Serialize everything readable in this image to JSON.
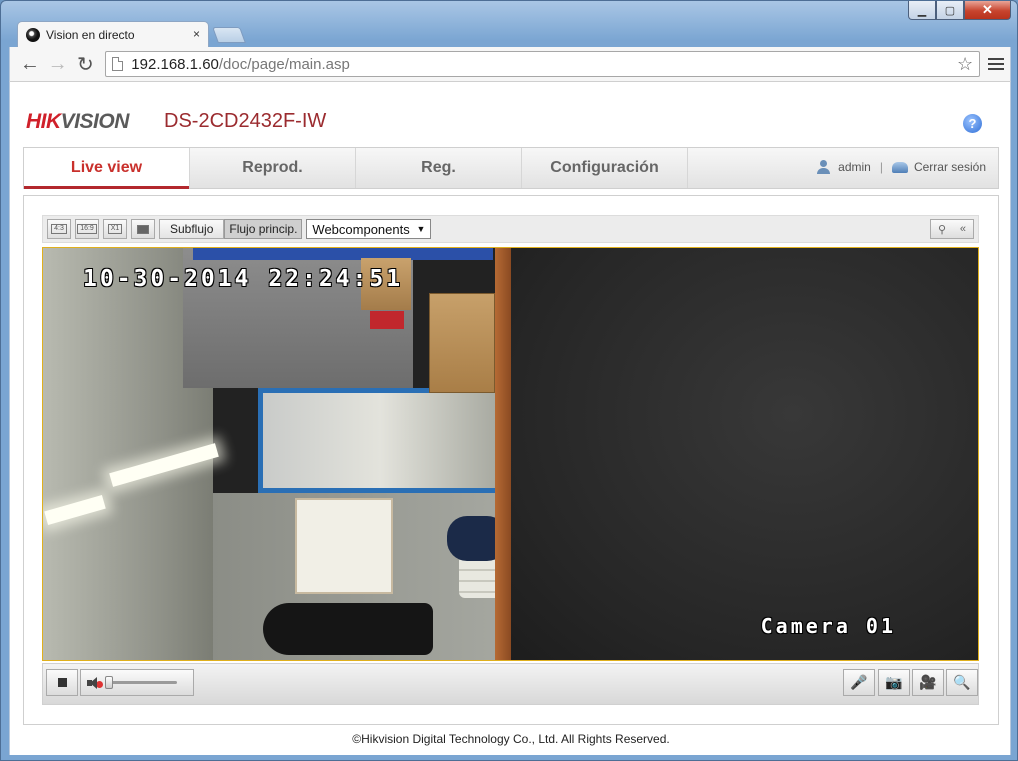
{
  "window": {
    "minimize": "▁",
    "maximize": "▢",
    "close": "✕"
  },
  "browser": {
    "tab_title": "Vision en directo",
    "tab_close": "×",
    "back": "←",
    "forward": "→",
    "reload": "↻",
    "url_host": "192.168.1.60",
    "url_path": "/doc/page/main.asp",
    "bookmark_star": "☆"
  },
  "header": {
    "brand_red": "HIK",
    "brand_gray": "VISION",
    "model": "DS-2CD2432F-IW",
    "help": "?"
  },
  "nav": {
    "tabs": [
      {
        "label": "Live view",
        "active": true
      },
      {
        "label": "Reprod.",
        "active": false
      },
      {
        "label": "Reg.",
        "active": false
      },
      {
        "label": "Configuración",
        "active": false
      }
    ],
    "user": "admin",
    "separator": "|",
    "logout": "Cerrar sesión"
  },
  "viewbar": {
    "ratio_4_3": "4:3",
    "ratio_16_9": "16:9",
    "ratio_x1": "X1",
    "substream": "Subflujo",
    "mainstream": "Flujo princip.",
    "plugin_select": "Webcomponents",
    "collapse": "«"
  },
  "video": {
    "osd_datetime": "10-30-2014 22:24:51",
    "osd_camera": "Camera 01"
  },
  "controls": {
    "volume_level": 0.0,
    "mic": "🎤",
    "snapshot": "📷",
    "record": "🎥",
    "zoom": "🔍"
  },
  "footer": {
    "copyright": "©Hikvision Digital Technology Co., Ltd. All Rights Reserved."
  },
  "icons": [
    "favicon-icon",
    "page-icon",
    "star-icon",
    "menu-icon",
    "help-icon",
    "user-icon",
    "logout-icon",
    "ptz-icon",
    "stop-icon",
    "speaker-muted-icon",
    "microphone-icon",
    "camera-icon",
    "record-icon",
    "zoom-icon"
  ],
  "colors": {
    "brand_red": "#d0202a",
    "model_text": "#9b2b2f",
    "active_tab": "#c9302c",
    "video_border": "#e0b01c"
  }
}
